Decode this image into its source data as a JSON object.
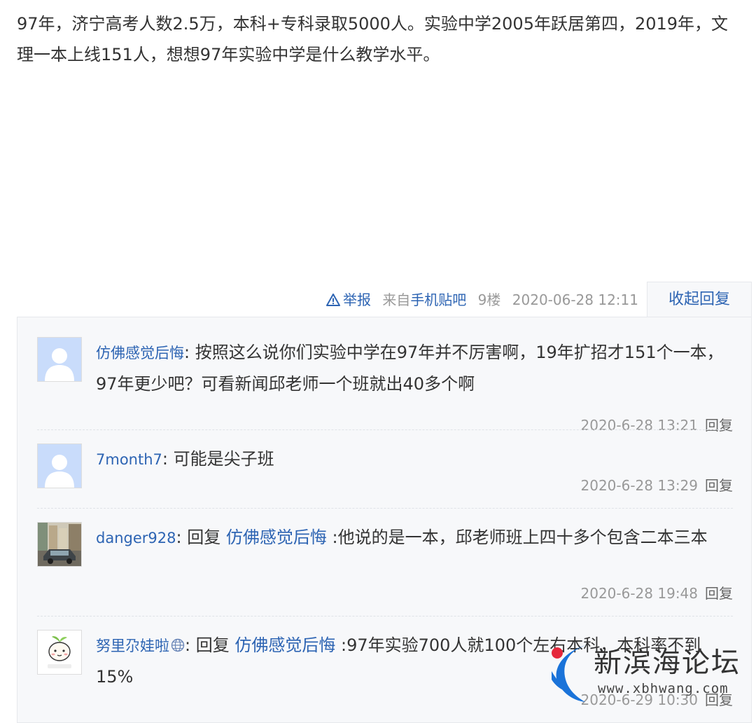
{
  "post": {
    "content": "97年，济宁高考人数2.5万，本科+专科录取5000人。实验中学2005年跃居第四，2019年，文理一本上线151人，想想97年实验中学是什么教学水平。"
  },
  "post_tail": {
    "report_label": "举报",
    "from_prefix": "来自",
    "from_client": "手机贴吧",
    "floor": "9楼",
    "time": "2020-06-28 12:11",
    "collapse_label": "收起回复"
  },
  "replies": [
    {
      "user": "仿佛感觉后悔",
      "avatar": "default-avatar",
      "reply_prefix": "",
      "reply_to": "",
      "text": "按照这么说你们实验中学在97年并不厉害啊，19年扩招才151个一本，97年更少吧？可看新闻邱老师一个班就出40多个啊",
      "time": "2020-6-28 13:21",
      "reply_label": "回复"
    },
    {
      "user": "7month7",
      "avatar": "default-avatar",
      "reply_prefix": "",
      "reply_to": "",
      "text": "可能是尖子班",
      "time": "2020-6-28 13:29",
      "reply_label": "回复"
    },
    {
      "user": "danger928",
      "avatar": "street-car-photo-avatar",
      "reply_prefix": "回复",
      "reply_to": "仿佛感觉后悔",
      "text": ":他说的是一本，邱老师班上四十多个包含二本三本",
      "time": "2020-6-28 19:48",
      "reply_label": "回复"
    },
    {
      "user": "努里尕娃啦",
      "avatar": "cartoon-sprout-avatar",
      "member_icon": "globe-icon",
      "reply_prefix": "回复",
      "reply_to": "仿佛感觉后悔",
      "text": ":97年实验700人就100个左右本科，本科率不到15%",
      "time": "2020-6-29 10:30",
      "reply_label": "回复"
    }
  ],
  "watermark": {
    "title": "新滨海论坛",
    "domain": "www.xbhwang.com"
  },
  "colors": {
    "link": "#2d64b3",
    "meta": "#999999",
    "text": "#333333",
    "panel_bg": "#f7f8fa",
    "watermark_blue": "#1a73d9",
    "watermark_red": "#e5283b"
  }
}
